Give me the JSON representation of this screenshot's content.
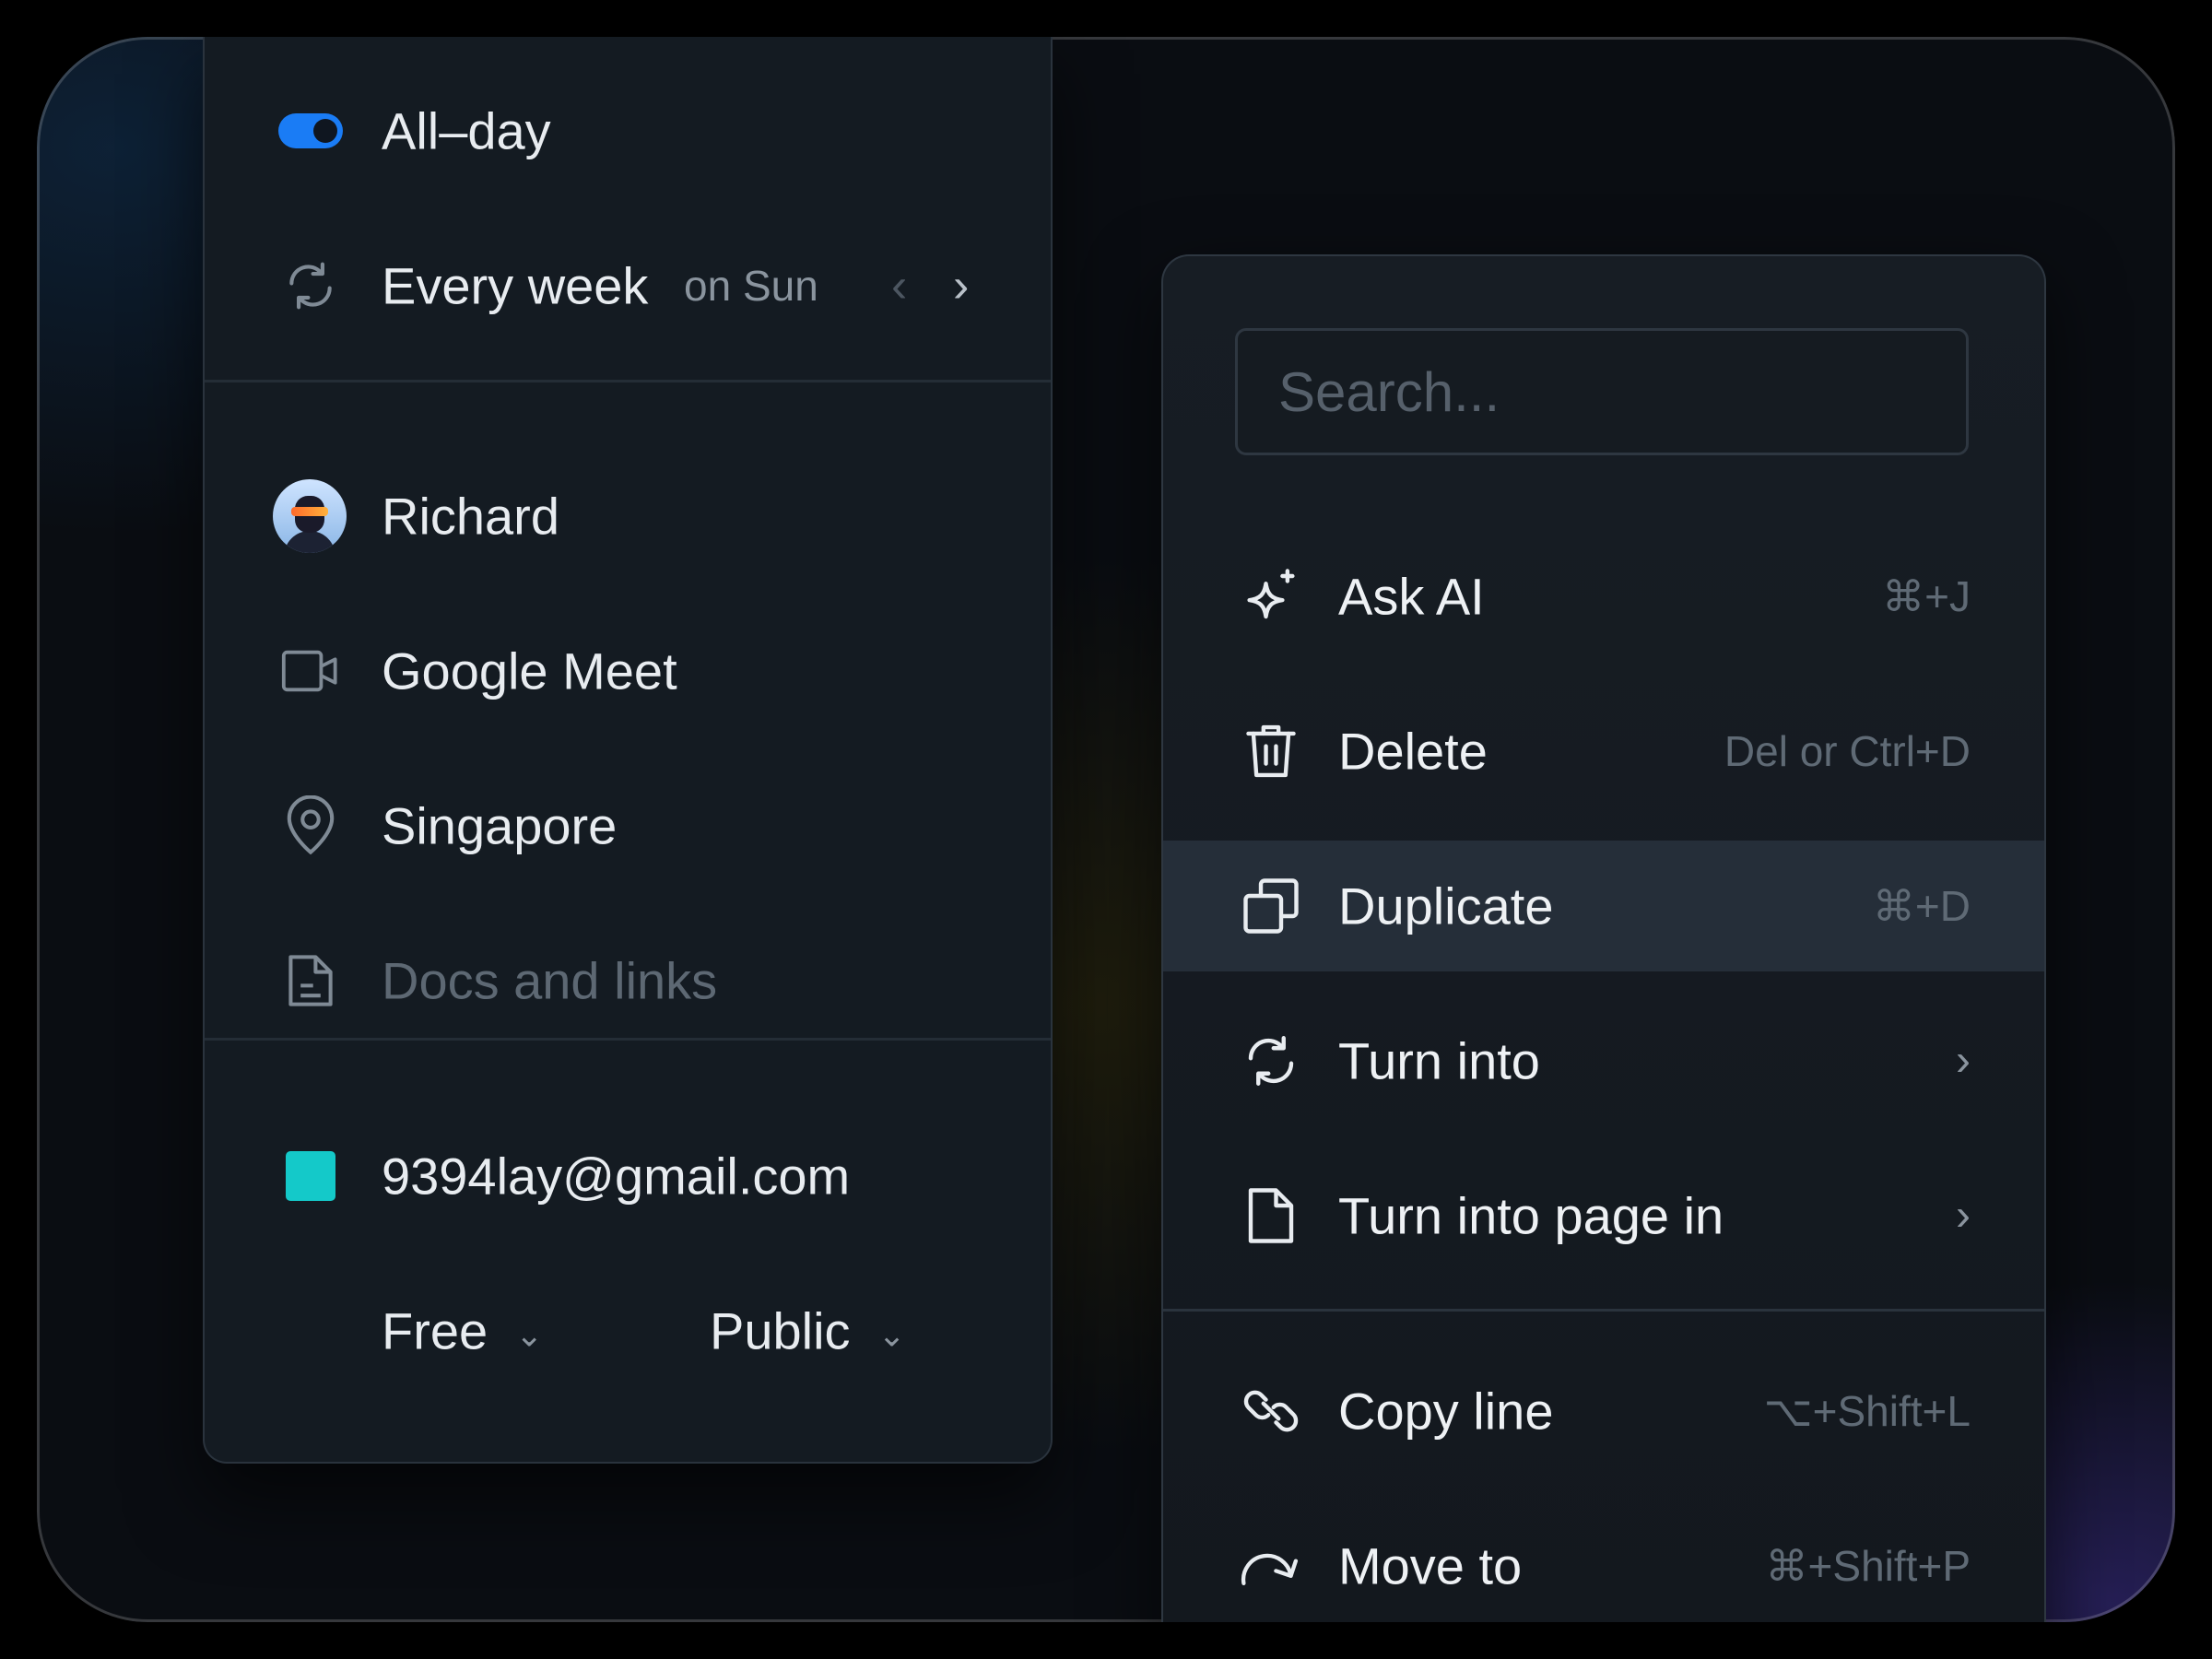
{
  "event_panel": {
    "all_day": {
      "label": "All–day",
      "enabled": true
    },
    "repeat": {
      "label": "Every week",
      "detail": "on Sun",
      "icon": "repeat-icon"
    },
    "organizer": {
      "name": "Richard"
    },
    "meeting": {
      "label": "Google Meet",
      "icon": "video-icon"
    },
    "location": {
      "label": "Singapore",
      "icon": "location-pin-icon"
    },
    "docs": {
      "label": "Docs and links",
      "icon": "document-icon"
    },
    "calendar": {
      "email": "9394lay@gmail.com",
      "color": "#14c9c9"
    },
    "availability": {
      "value": "Free"
    },
    "visibility": {
      "value": "Public"
    }
  },
  "context_menu": {
    "search_placeholder": "Search...",
    "items": [
      {
        "label": "Ask AI",
        "shortcut": "⌘+J",
        "icon": "sparkle-icon"
      },
      {
        "label": "Delete",
        "shortcut": "Del or Ctrl+D",
        "icon": "trash-icon"
      },
      {
        "label": "Duplicate",
        "shortcut": "⌘+D",
        "icon": "duplicate-icon",
        "highlighted": true
      },
      {
        "label": "Turn into",
        "icon": "convert-icon",
        "submenu": true
      },
      {
        "label": "Turn into page in",
        "icon": "page-icon",
        "submenu": true
      },
      {
        "label": "Copy line",
        "shortcut": "⌥+Shift+L",
        "icon": "link-icon"
      },
      {
        "label": "Move to",
        "shortcut": "⌘+Shift+P",
        "icon": "move-arrow-icon"
      }
    ]
  },
  "colors": {
    "accent": "#1a7cf5",
    "highlight_row": "#252e39",
    "panel_bg": "#141b22"
  }
}
